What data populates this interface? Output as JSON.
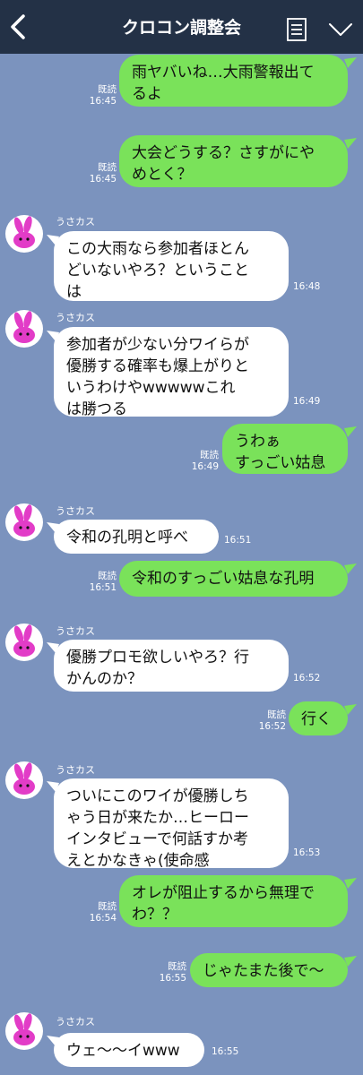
{
  "header": {
    "title": "クロコン調整会",
    "back_icon": "chevron-left-icon",
    "menu_icon": "notes-icon",
    "expand_icon": "chevron-down-icon"
  },
  "colors": {
    "header_bg": "#233146",
    "chat_bg": "#7b93be",
    "my_bubble": "#7ae25a",
    "other_bubble": "#ffffff",
    "avatar_rabbit": "#e23cc7"
  },
  "messages": [
    {
      "from": "me",
      "text": "雨ヤバいね…大雨警報出て\nるよ",
      "read": "既読",
      "time": "16:45"
    },
    {
      "from": "me",
      "text": "大会どうする？さすがにや\nめとく？",
      "read": "既読",
      "time": "16:45"
    },
    {
      "from": "other",
      "name": "うさカス",
      "text": "この大雨なら参加者ほとん\nどいないやろ？ということ\nは",
      "time": "16:48"
    },
    {
      "from": "other",
      "name": "うさカス",
      "text": "参加者が少ない分ワイらが\n優勝する確率も爆上がりと\nいうわけやwwwwwこれ\nは勝つる",
      "time": "16:49"
    },
    {
      "from": "me",
      "text": "うわぁ\nすっごい姑息",
      "read": "既読",
      "time": "16:49"
    },
    {
      "from": "other",
      "name": "うさカス",
      "text": "令和の孔明と呼べ",
      "time": "16:51"
    },
    {
      "from": "me",
      "text": "令和のすっごい姑息な孔明",
      "read": "既読",
      "time": "16:51"
    },
    {
      "from": "other",
      "name": "うさカス",
      "text": "優勝プロモ欲しいやろ？行\nかんのか？",
      "time": "16:52"
    },
    {
      "from": "me",
      "text": "行く",
      "read": "既読",
      "time": "16:52"
    },
    {
      "from": "other",
      "name": "うさカス",
      "text": "ついにこのワイが優勝しち\nゃう日が来たか…ヒーロー\nインタビューで何話すか考\nえとかなきゃ(使命感",
      "time": "16:53"
    },
    {
      "from": "me",
      "text": "オレが阻止するから無理で\nわ？？",
      "read": "既読",
      "time": "16:54"
    },
    {
      "from": "me",
      "text": "じゃたまた後で〜",
      "read": "既読",
      "time": "16:55"
    },
    {
      "from": "other",
      "name": "うさカス",
      "text": "ウェ〜〜イwww",
      "time": "16:55"
    }
  ]
}
